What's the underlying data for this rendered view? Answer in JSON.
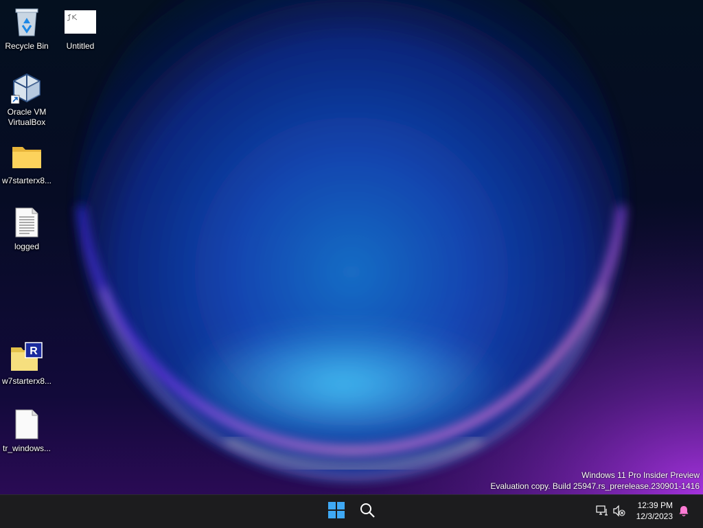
{
  "desktop_icons": [
    {
      "id": "recycle-bin",
      "label": "Recycle Bin",
      "icon": "recycle-bin-icon"
    },
    {
      "id": "untitled",
      "label": "Untitled",
      "icon": "image-thumbnail-icon"
    },
    {
      "id": "virtualbox",
      "label": "Oracle VM VirtualBox",
      "icon": "virtualbox-icon"
    },
    {
      "id": "folder",
      "label": "w7starterx8...",
      "icon": "folder-icon"
    },
    {
      "id": "logged",
      "label": "logged",
      "icon": "text-document-icon"
    },
    {
      "id": "archive",
      "label": "w7starterx8...",
      "icon": "rar-archive-icon"
    },
    {
      "id": "tr-windows",
      "label": "tr_windows...",
      "icon": "blank-file-icon"
    }
  ],
  "watermark": {
    "line1": "Windows 11 Pro Insider Preview",
    "line2": "Evaluation copy. Build 25947.rs_prerelease.230901-1416"
  },
  "taskbar": {
    "start_icon": "windows-start-icon",
    "search_icon": "search-icon",
    "tray": {
      "network_icon": "network-icon",
      "volume_icon": "volume-muted-icon",
      "notification_icon": "notification-bell-icon",
      "time": "12:39 PM",
      "date": "12/3/2023"
    }
  },
  "colors": {
    "taskbar": "#1c1c1e",
    "start_blue": "#3fa9f5",
    "accent_pink": "#ff7bd5"
  }
}
